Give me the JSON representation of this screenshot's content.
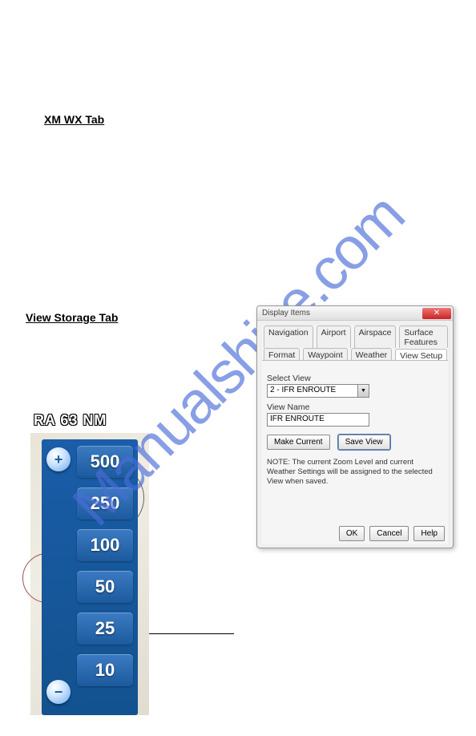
{
  "watermark": "Manualshive.com",
  "headings": {
    "xm_wx": "XM WX Tab",
    "view_storage": "View Storage Tab"
  },
  "zoom_panel": {
    "header_prefix": "RA",
    "header_value": "63",
    "header_unit": "NM",
    "levels": [
      "500",
      "250",
      "100",
      "50",
      "25",
      "10"
    ]
  },
  "dialog": {
    "title": "Display Items",
    "tabs_row1": [
      "Navigation",
      "Airport",
      "Airspace",
      "Surface Features"
    ],
    "tabs_row2": [
      "Format",
      "Waypoint",
      "Weather",
      "View Setup"
    ],
    "active_tab": "View Setup",
    "select_view_label": "Select View",
    "select_view_value": "2 - IFR ENROUTE",
    "view_name_label": "View Name",
    "view_name_value": "IFR ENROUTE",
    "make_current_label": "Make Current",
    "save_view_label": "Save View",
    "note_text": "NOTE: The current Zoom Level and current Weather Settings will be assigned to the selected View when saved.",
    "footer": {
      "ok": "OK",
      "cancel": "Cancel",
      "help": "Help"
    }
  }
}
